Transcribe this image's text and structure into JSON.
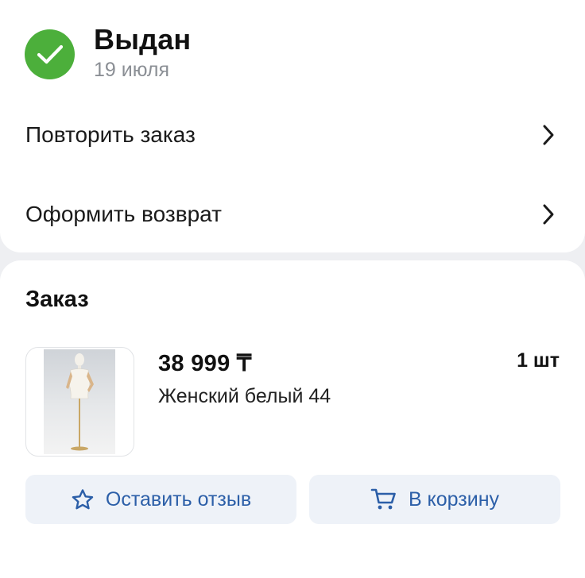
{
  "status": {
    "title": "Выдан",
    "date": "19 июля",
    "icon": "check-icon",
    "color": "#4caf3b"
  },
  "actions": [
    {
      "label": "Повторить заказ",
      "icon": "chevron-right-icon"
    },
    {
      "label": "Оформить возврат",
      "icon": "chevron-right-icon"
    }
  ],
  "order": {
    "title": "Заказ",
    "item": {
      "price": "38 999 ₸",
      "quantity": "1 шт",
      "name": "Женский белый 44",
      "image": "mannequin-photo"
    },
    "buttons": {
      "review_label": "Оставить отзыв",
      "review_icon": "star-icon",
      "cart_label": "В корзину",
      "cart_icon": "cart-icon"
    }
  },
  "colors": {
    "accent": "#2c5fa8",
    "button_bg": "#eef2f8",
    "background": "#eeeff2"
  }
}
